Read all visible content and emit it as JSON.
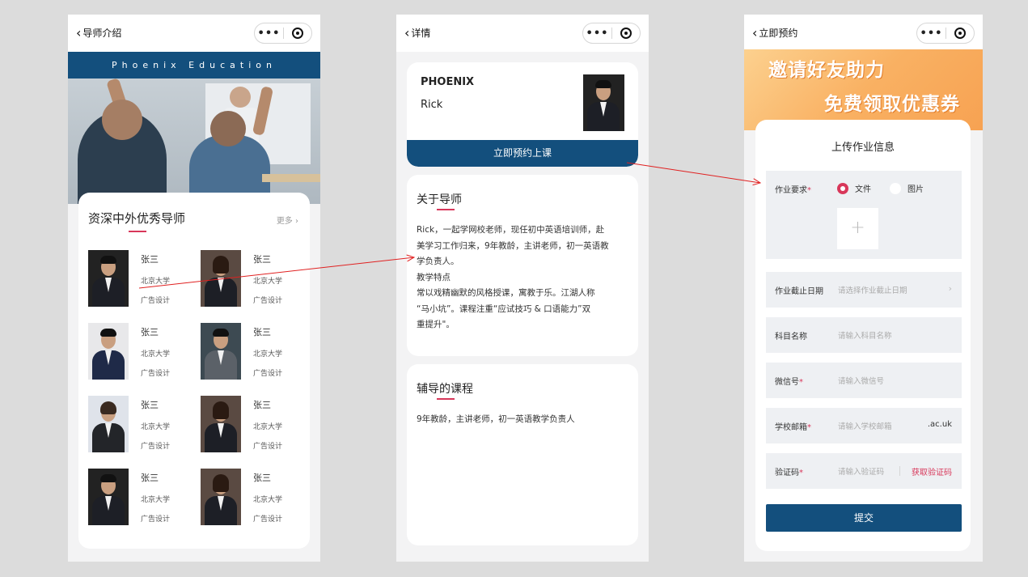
{
  "screen1": {
    "nav_title": "导师介绍",
    "brand_bar": "Phoenix Education",
    "section_title": "资深中外优秀导师",
    "more_link": "更多 ›",
    "teachers": [
      {
        "name": "张三",
        "school": "北京大学",
        "major": "广告设计"
      },
      {
        "name": "张三",
        "school": "北京大学",
        "major": "广告设计"
      },
      {
        "name": "张三",
        "school": "北京大学",
        "major": "广告设计"
      },
      {
        "name": "张三",
        "school": "北京大学",
        "major": "广告设计"
      },
      {
        "name": "张三",
        "school": "北京大学",
        "major": "广告设计"
      },
      {
        "name": "张三",
        "school": "北京大学",
        "major": "广告设计"
      },
      {
        "name": "张三",
        "school": "北京大学",
        "major": "广告设计"
      },
      {
        "name": "张三",
        "school": "北京大学",
        "major": "广告设计"
      }
    ]
  },
  "screen2": {
    "nav_title": "详情",
    "brand": "PHOENIX",
    "teacher_name": "Rick",
    "book_button": "立即预约上课",
    "about": {
      "title": "关于导师",
      "lines": [
        "Rick，一起学网校老师，现任初中英语培训师，赴",
        "美学习工作归来，9年教龄，主讲老师，初一英语教",
        "学负责人。",
        "教学特点",
        "常以戏精幽默的风格授课，寓教于乐。江湖人称",
        "“马小坑”。课程注重“应试技巧 & 口语能力”双",
        "重提升\"。"
      ]
    },
    "courses": {
      "title": "辅导的课程",
      "text": "9年教龄，主讲老师，初一英语教学负责人"
    }
  },
  "screen3": {
    "nav_title": "立即预约",
    "banner_line1": "邀请好友助力",
    "banner_line2": "免费领取优惠券",
    "form_title": "上传作业信息",
    "homework_label": "作业要求",
    "option_file": "文件",
    "option_image": "图片",
    "upload_plus": "+",
    "deadline_label": "作业截止日期",
    "deadline_placeholder": "请选择作业截止日期",
    "subject_label": "科目名称",
    "subject_placeholder": "请输入科目名称",
    "wechat_label": "微信号",
    "wechat_placeholder": "请输入微信号",
    "email_label": "学校邮箱",
    "email_placeholder": "请输入学校邮箱",
    "email_suffix": ".ac.uk",
    "code_label": "验证码",
    "code_placeholder": "请输入验证码",
    "get_code": "获取验证码",
    "submit": "提交"
  },
  "capsule": {
    "more": "•••"
  },
  "colors": {
    "primary": "#134f7d",
    "accent": "#d8375a",
    "arrow": "#e02020"
  }
}
